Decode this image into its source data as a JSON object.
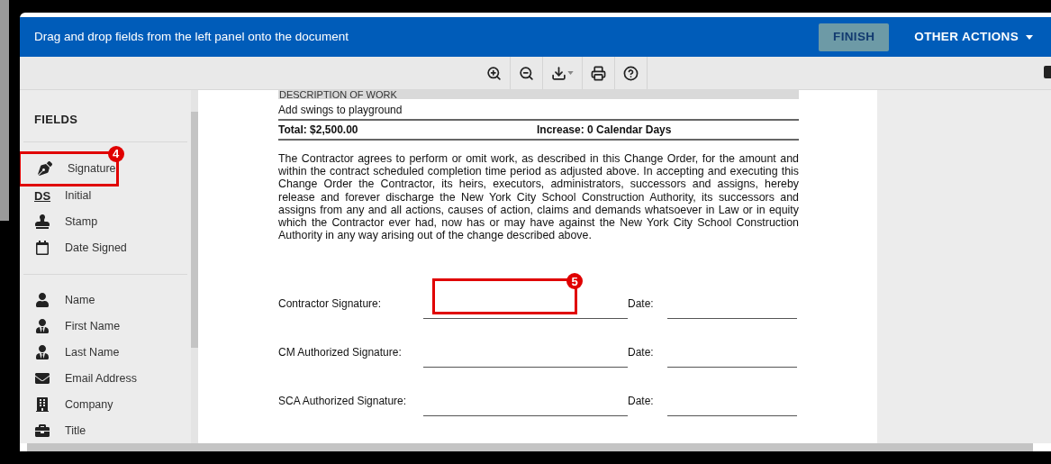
{
  "header": {
    "message": "Drag and drop fields from the left panel onto the document",
    "finish_button": {
      "label": "FINISH",
      "disabled": true
    },
    "other_actions": {
      "label": "OTHER ACTIONS"
    }
  },
  "toolbar": {
    "tools": [
      {
        "kind": "zoom-in"
      },
      {
        "kind": "zoom-out"
      },
      {
        "kind": "download"
      },
      {
        "kind": "print"
      },
      {
        "kind": "help"
      }
    ]
  },
  "sidebar": {
    "title": "FIELDS",
    "groups": [
      [
        {
          "kind": "signature",
          "label": "Signature",
          "annotation": "4"
        },
        {
          "kind": "initial",
          "label": "Initial",
          "glyph": "DS"
        },
        {
          "kind": "stamp",
          "label": "Stamp"
        },
        {
          "kind": "date",
          "label": "Date Signed"
        }
      ],
      [
        {
          "kind": "name",
          "label": "Name"
        },
        {
          "kind": "first-name",
          "label": "First Name"
        },
        {
          "kind": "last-name",
          "label": "Last Name"
        },
        {
          "kind": "email",
          "label": "Email Address"
        },
        {
          "kind": "company",
          "label": "Company"
        },
        {
          "kind": "title",
          "label": "Title"
        }
      ]
    ]
  },
  "document": {
    "section_heading": "DESCRIPTION OF WORK",
    "description": "Add swings to playground",
    "total": "Total: $2,500.00",
    "increase": "Increase: 0 Calendar Days",
    "paragraph": "The Contractor agrees to perform or omit work, as described in this Change Order, for the amount and within the contract scheduled completion time period as adjusted above. In accepting and executing this Change Order the Contractor, its heirs, executors, administrators, successors and assigns, hereby release and forever discharge the New York City School Construction Authority, its successors and assigns from any and all actions, causes of action, claims and demands whatsoever in Law or in equity which the Contractor ever had, now has or may have against the New York City School Construction Authority in any way arising out of the change described above.",
    "signature_rows": [
      {
        "label": "Contractor Signature:",
        "date_label": "Date:",
        "annotation": "5"
      },
      {
        "label": "CM Authorized Signature:",
        "date_label": "Date:"
      },
      {
        "label": "SCA Authorized Signature:",
        "date_label": "Date:"
      }
    ]
  }
}
